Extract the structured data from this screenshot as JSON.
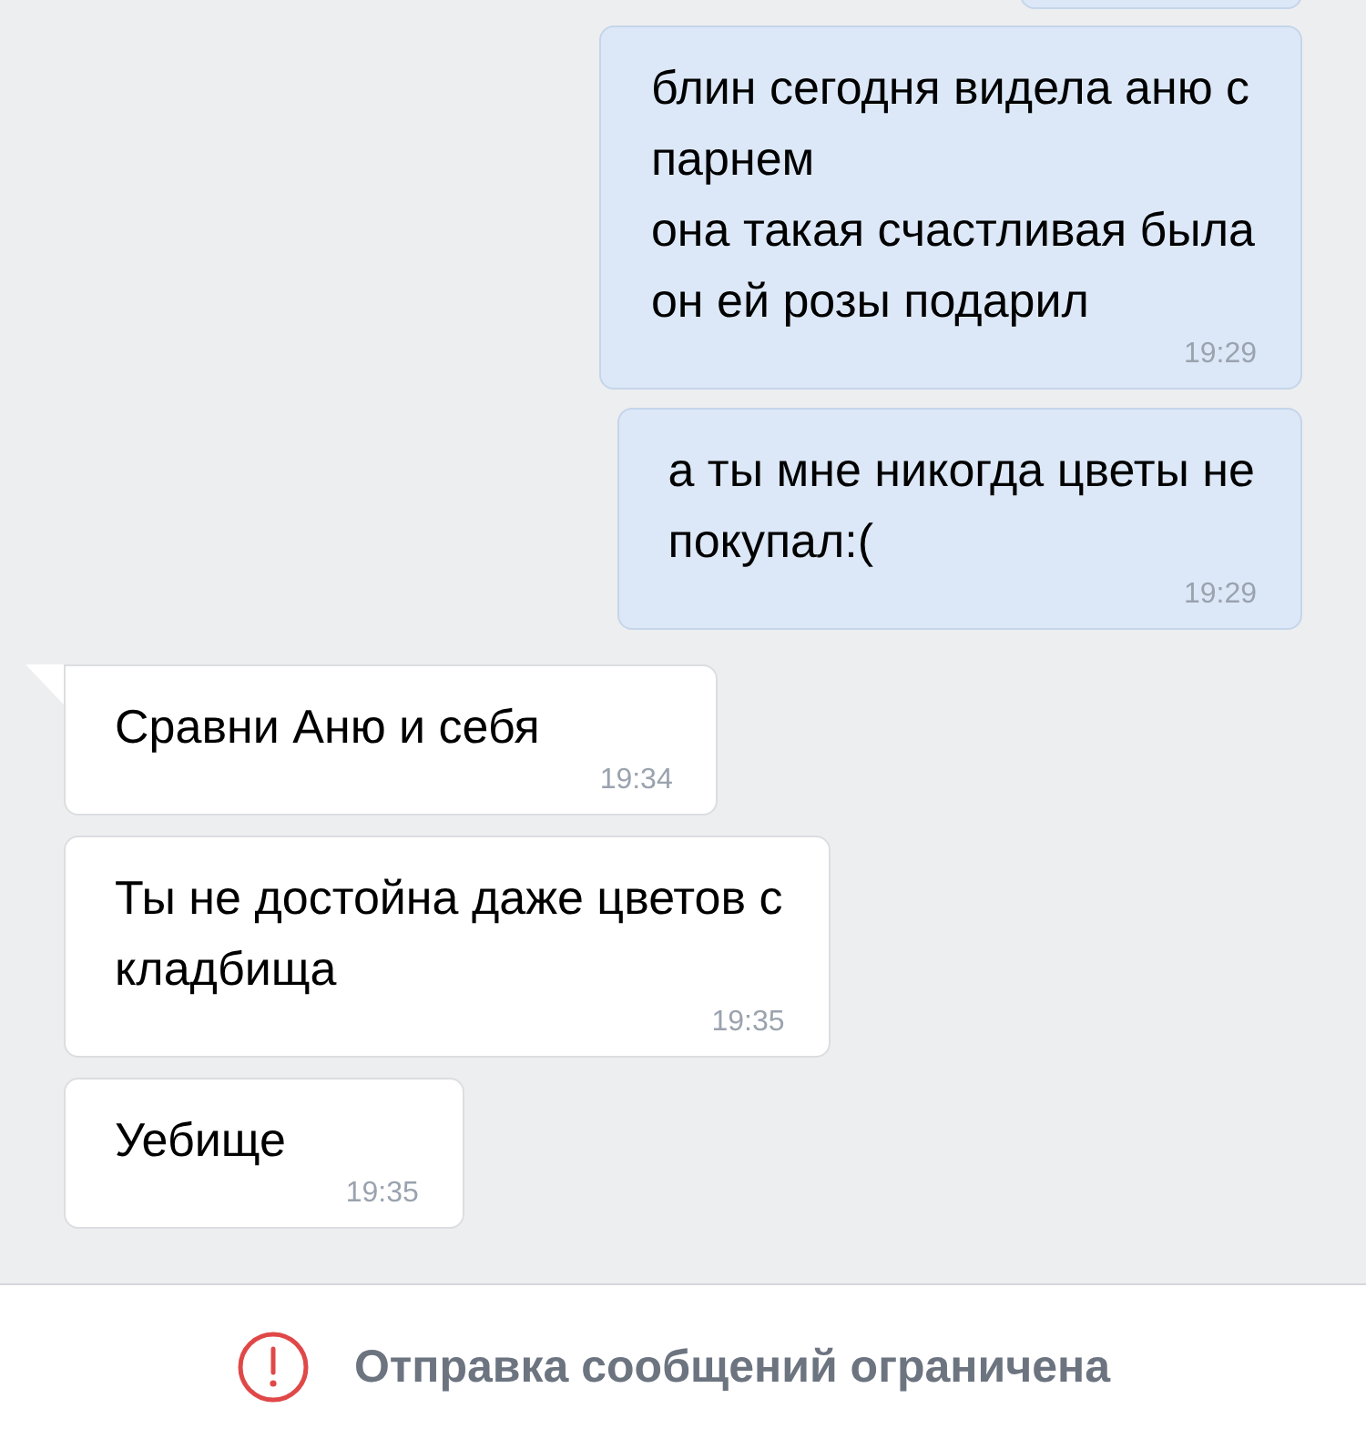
{
  "messages": [
    {
      "kind": "out",
      "cut_off": true
    },
    {
      "kind": "out",
      "cut_off": false,
      "text": "блин сегодня видела аню с\nпарнем\nона такая счастливая была\nон ей розы подарил",
      "time": "19:29",
      "tail": false
    },
    {
      "kind": "out",
      "cut_off": false,
      "text": "а ты мне никогда цветы не\nпокупал:(",
      "time": "19:29",
      "tail": false
    },
    {
      "kind": "in",
      "cut_off": false,
      "text": "Сравни Аню и себя",
      "time": "19:34",
      "tail": true
    },
    {
      "kind": "in",
      "cut_off": false,
      "text": "Ты не достойна даже цветов с\nкладбища",
      "time": "19:35",
      "tail": false
    },
    {
      "kind": "in",
      "cut_off": false,
      "text": "Уебище",
      "time": "19:35",
      "tail": false
    }
  ],
  "footer": {
    "text": "Отправка сообщений ограничена"
  }
}
